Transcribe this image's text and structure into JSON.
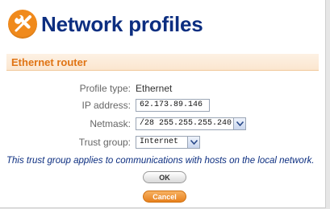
{
  "header": {
    "title": "Network profiles",
    "icon": "wrench-screwdriver-icon",
    "icon_color": "#f08a1c",
    "title_color": "#0c2e80"
  },
  "section": {
    "title": "Ethernet router",
    "accent": "#e07414"
  },
  "form": {
    "profile_type_label": "Profile type:",
    "profile_type_value": "Ethernet",
    "ip_label": "IP address:",
    "ip_value": "62.173.89.146",
    "netmask_label": "Netmask:",
    "netmask_value": "/28 255.255.255.240",
    "trust_label": "Trust group:",
    "trust_value": "Internet"
  },
  "info_text": "This trust group applies to communications with hosts on the local network.",
  "buttons": {
    "ok": "OK",
    "cancel": "Cancel"
  }
}
